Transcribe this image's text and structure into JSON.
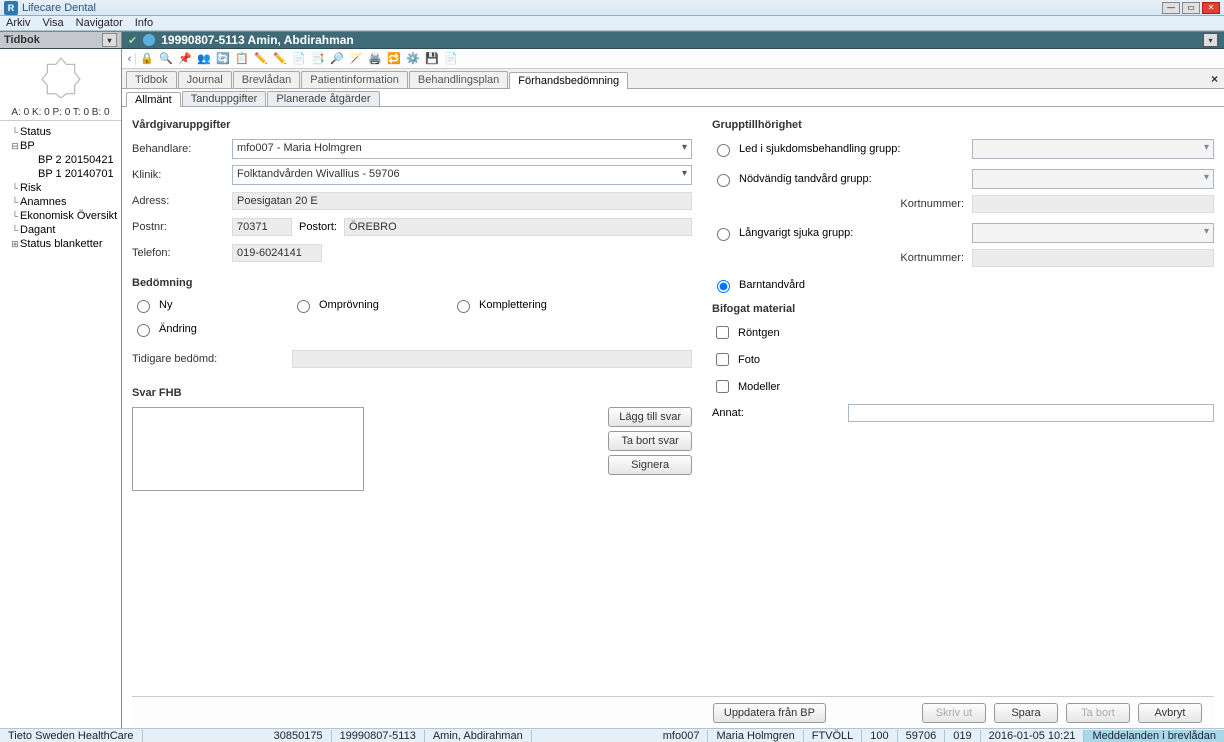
{
  "title": "Lifecare Dental",
  "menu": [
    "Arkiv",
    "Visa",
    "Navigator",
    "Info"
  ],
  "tidbok_label": "Tidbok",
  "patient_header": "19990807-5113 Amin, Abdirahman",
  "counters": "A: 0  K: 0  P: 0  T: 0  B: 0",
  "tree": {
    "status": "Status",
    "bp": "BP",
    "bp_children": [
      "BP 2 20150421",
      "BP 1 20140701"
    ],
    "risk": "Risk",
    "anamnes": "Anamnes",
    "ekonomi": "Ekonomisk Översikt",
    "daganti": "Dagant",
    "blanketter": "Status blanketter"
  },
  "toolbar_icons": [
    "🔒",
    "🔍",
    "📌",
    "👥",
    "🔄",
    "📋",
    "✏️",
    "✏️",
    "📄",
    "📑",
    "🔎",
    "🪄",
    "🖨️",
    "🔁",
    "⚙️",
    "💾",
    "📄"
  ],
  "tabs_upper": [
    "Tidbok",
    "Journal",
    "Brevlådan",
    "Patientinformation",
    "Behandlingsplan",
    "Förhandsbedömning"
  ],
  "tabs_upper_active": 5,
  "tabs_lower": [
    "Allmänt",
    "Tanduppgifter",
    "Planerade åtgärder"
  ],
  "tabs_lower_active": 0,
  "sections": {
    "vardgivar": "Vårdgivaruppgifter",
    "bedomning": "Bedömning",
    "svar": "Svar FHB",
    "grupp": "Grupptillhörighet",
    "bifogat": "Bifogat material"
  },
  "labels": {
    "behandlare": "Behandlare:",
    "klinik": "Klinik:",
    "adress": "Adress:",
    "postnr": "Postnr:",
    "postort": "Postort:",
    "telefon": "Telefon:",
    "tidigare": "Tidigare bedömd:",
    "kort": "Kortnummer:",
    "annat": "Annat:"
  },
  "values": {
    "behandlare": "mfo007 - Maria Holmgren",
    "klinik": "Folktandvården Wivallius - 59706",
    "adress": "Poesigatan 20 E",
    "postnr": "70371",
    "postort": "ÖREBRO",
    "telefon": "019-6024141"
  },
  "bedomning_opts": {
    "ny": "Ny",
    "omprovning": "Omprövning",
    "komplettering": "Komplettering",
    "andring": "Ändring"
  },
  "grupp_opts": {
    "led": "Led i sjukdomsbehandling grupp:",
    "nodv": "Nödvändig tandvård grupp:",
    "langv": "Långvarigt sjuka grupp:",
    "barn": "Barntandvård"
  },
  "bifogat_opts": {
    "rontgen": "Röntgen",
    "foto": "Foto",
    "modeller": "Modeller"
  },
  "svar_btns": {
    "add": "Lägg till svar",
    "remove": "Ta bort svar",
    "sign": "Signera"
  },
  "action_btns": {
    "uppdatera": "Uppdatera från BP",
    "skriv": "Skriv ut",
    "spara": "Spara",
    "tabort": "Ta bort",
    "avbryt": "Avbryt"
  },
  "status": {
    "company": "Tieto Sweden HealthCare",
    "id1": "30850175",
    "pnr": "19990807-5113",
    "name": "Amin, Abdirahman",
    "user": "mfo007",
    "user_name": "Maria Holmgren",
    "org": "FTVÖLL",
    "n1": "100",
    "n2": "59706",
    "n3": "019",
    "ts": "2016-01-05 10:21",
    "msg": "Meddelanden i brevlådan"
  }
}
